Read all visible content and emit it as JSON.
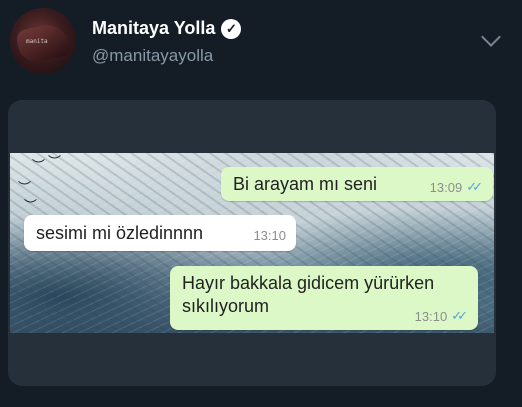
{
  "tweet": {
    "display_name": "Manitaya Yolla",
    "handle": "@manitayayolla",
    "verified_icon": "verified-badge-icon",
    "avatar_mark": "manita"
  },
  "chat": {
    "messages": [
      {
        "direction": "outgoing",
        "text": "Bi arayam mı seni",
        "time": "13:09",
        "status_icon": "double-check-icon"
      },
      {
        "direction": "incoming",
        "text": "sesimi mi özledinnnn",
        "time": "13:10"
      },
      {
        "direction": "outgoing",
        "text": "Hayır bakkala gidicem yürürken sıkılıyorum",
        "time": "13:10",
        "status_icon": "double-check-icon"
      }
    ]
  },
  "colors": {
    "background": "#141d26",
    "outgoing_bubble": "#dcf8c6",
    "incoming_bubble": "#ffffff",
    "read_ticks": "#4fa6e0",
    "secondary_text": "#8899a6"
  }
}
